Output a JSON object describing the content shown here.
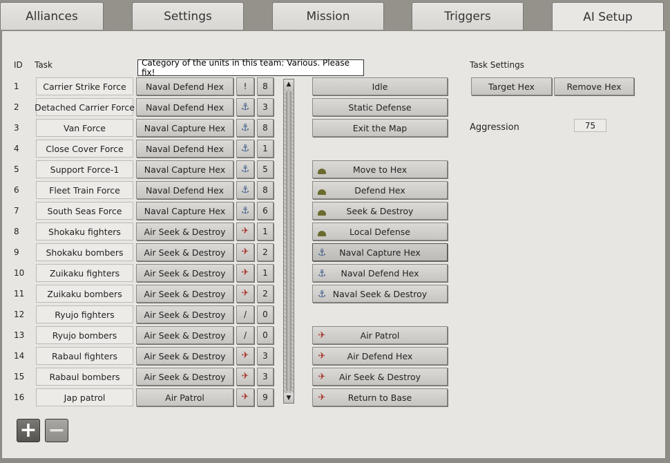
{
  "tabs": [
    "Alliances",
    "Settings",
    "Mission",
    "Triggers",
    "AI Setup"
  ],
  "active_tab": "AI Setup",
  "headers": {
    "id": "ID",
    "task": "Task",
    "task_settings": "Task Settings"
  },
  "tooltip": "Category of the units in this team: Various. Please fix!",
  "rows": [
    {
      "id": "1",
      "name": "Carrier Strike Force",
      "task": "Naval Defend Hex",
      "cat": "!",
      "cat_icon": "none",
      "agg": "8"
    },
    {
      "id": "2",
      "name": "Detached Carrier Force",
      "task": "Naval Defend Hex",
      "cat": "",
      "cat_icon": "anchor-icon",
      "agg": "3"
    },
    {
      "id": "3",
      "name": "Van Force",
      "task": "Naval Capture Hex",
      "cat": "",
      "cat_icon": "anchor-icon",
      "agg": "8"
    },
    {
      "id": "4",
      "name": "Close Cover Force",
      "task": "Naval Defend Hex",
      "cat": "",
      "cat_icon": "anchor-icon",
      "agg": "1"
    },
    {
      "id": "5",
      "name": "Support Force-1",
      "task": "Naval Capture Hex",
      "cat": "",
      "cat_icon": "anchor-icon",
      "agg": "5"
    },
    {
      "id": "6",
      "name": "Fleet Train Force",
      "task": "Naval Defend Hex",
      "cat": "",
      "cat_icon": "anchor-icon",
      "agg": "8"
    },
    {
      "id": "7",
      "name": "South Seas Force",
      "task": "Naval Capture Hex",
      "cat": "",
      "cat_icon": "anchor-icon",
      "agg": "6"
    },
    {
      "id": "8",
      "name": "Shokaku fighters",
      "task": "Air Seek & Destroy",
      "cat": "",
      "cat_icon": "plane-icon",
      "agg": "1"
    },
    {
      "id": "9",
      "name": "Shokaku bombers",
      "task": "Air Seek & Destroy",
      "cat": "",
      "cat_icon": "plane-icon",
      "agg": "2"
    },
    {
      "id": "10",
      "name": "Zuikaku fighters",
      "task": "Air Seek & Destroy",
      "cat": "",
      "cat_icon": "plane-icon",
      "agg": "1"
    },
    {
      "id": "11",
      "name": "Zuikaku bombers",
      "task": "Air Seek & Destroy",
      "cat": "",
      "cat_icon": "plane-icon",
      "agg": "2"
    },
    {
      "id": "12",
      "name": "Ryujo fighters",
      "task": "Air Seek & Destroy",
      "cat": "/",
      "cat_icon": "none",
      "agg": "0"
    },
    {
      "id": "13",
      "name": "Ryujo bombers",
      "task": "Air Seek & Destroy",
      "cat": "/",
      "cat_icon": "none",
      "agg": "0"
    },
    {
      "id": "14",
      "name": "Rabaul fighters",
      "task": "Air Seek & Destroy",
      "cat": "",
      "cat_icon": "plane-icon",
      "agg": "3"
    },
    {
      "id": "15",
      "name": "Rabaul bombers",
      "task": "Air Seek & Destroy",
      "cat": "",
      "cat_icon": "plane-icon",
      "agg": "3"
    },
    {
      "id": "16",
      "name": "Jap patrol",
      "task": "Air Patrol",
      "cat": "",
      "cat_icon": "plane-icon",
      "agg": "9"
    }
  ],
  "task_options": [
    {
      "label": "Idle",
      "icon": "none"
    },
    {
      "label": "Static Defense",
      "icon": "none"
    },
    {
      "label": "Exit the Map",
      "icon": "none"
    },
    {
      "label": "Move to Hex",
      "icon": "helmet-icon"
    },
    {
      "label": "Defend Hex",
      "icon": "helmet-icon"
    },
    {
      "label": "Seek & Destroy",
      "icon": "helmet-icon"
    },
    {
      "label": "Local Defense",
      "icon": "helmet-icon"
    },
    {
      "label": "Naval Capture Hex",
      "icon": "anchor-icon",
      "selected": true
    },
    {
      "label": "Naval Defend Hex",
      "icon": "anchor-icon"
    },
    {
      "label": "Naval Seek & Destroy",
      "icon": "anchor-icon"
    },
    {
      "label": "Air Patrol",
      "icon": "plane-icon"
    },
    {
      "label": "Air Defend Hex",
      "icon": "plane-icon"
    },
    {
      "label": "Air Seek & Destroy",
      "icon": "plane-icon"
    },
    {
      "label": "Return to Base",
      "icon": "plane-icon"
    }
  ],
  "task_settings": {
    "target_hex": "Target Hex",
    "remove_hex": "Remove Hex",
    "aggression_label": "Aggression",
    "aggression_value": "75"
  },
  "controls": {
    "add_icon": "plus-icon",
    "remove_icon": "minus-icon"
  },
  "colors": {
    "anchor": "#3a5a8a",
    "plane": "#a8342c",
    "helmet": "#6b6b2f",
    "panel": "#e8e6e2"
  }
}
